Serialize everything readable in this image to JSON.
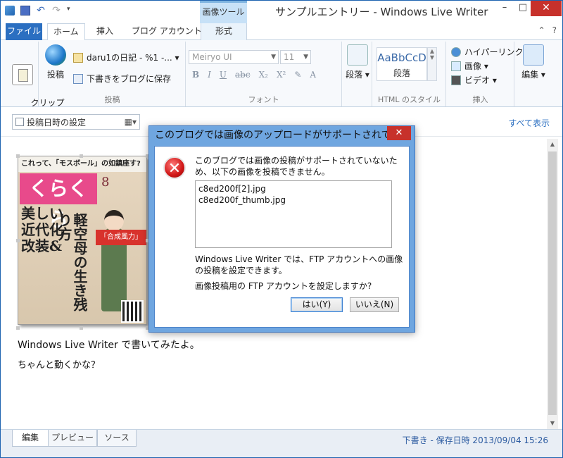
{
  "window": {
    "title": "サンプルエントリー - Windows Live Writer",
    "contextual_tab_group": "画像ツール",
    "controls": {
      "minimize": "–",
      "maximize": "□",
      "close": "✕"
    }
  },
  "quick_access": {
    "undo": "↶",
    "redo": "↷",
    "dropdown": "▾"
  },
  "tabs": {
    "file": "ファイル",
    "home": "ホーム",
    "insert": "挿入",
    "blog_account": "ブログ アカウント",
    "format": "形式"
  },
  "ribbon_right": {
    "help": "?",
    "expand": "⌃"
  },
  "ribbon": {
    "clipboard": {
      "label": "クリップ\nボード ▾"
    },
    "post": {
      "publish_label": "投稿",
      "blog_selector": "daru1の日記 - %1 -... ▾",
      "save_draft_label": "下書きをブログに保存",
      "group_label": "投稿"
    },
    "font": {
      "font_name": "Meiryo UI",
      "font_size": "11",
      "group_label": "フォント",
      "buttons": [
        "B",
        "I",
        "U",
        "abc",
        "X₂",
        "X²",
        "✎",
        "A"
      ]
    },
    "paragraph": {
      "label": "段落 ▾"
    },
    "html_styles": {
      "sample": "AaBbCcD",
      "name": "段落",
      "group_label": "HTML のスタイル"
    },
    "insert": {
      "hyperlink": "ハイパーリンク",
      "image": "画像 ▾",
      "video": "ビデオ ▾",
      "group_label": "挿入"
    },
    "editing": {
      "label": "編集 ▾"
    }
  },
  "option_bar": {
    "post_date_label": "投稿日時の設定",
    "show_all": "すべて表示"
  },
  "editor": {
    "magazine": {
      "top_strip": "これって、「モスボール」の如鎮座す?",
      "logo": "くらくら",
      "month": "8",
      "headline_left": "美しい近代化改装&",
      "headline_vertical": "軽空母の生き残り方",
      "banner": "「合成風力」"
    },
    "line1": "Windows Live Writer で書いてみたよ。",
    "line2": "ちゃんと動くかな？"
  },
  "bottom": {
    "tab_edit": "編集",
    "tab_preview": "プレビュー",
    "tab_source": "ソース",
    "status": "下書き - 保存日時 2013/09/04 15:26"
  },
  "dialog": {
    "title": "このブログでは画像のアップロードがサポートされていま...",
    "close": "✕",
    "message": "このブログでは画像の投稿がサポートされていないため、以下の画像を投稿できません。",
    "files": [
      "c8ed200f[2].jpg",
      "c8ed200f_thumb.jpg"
    ],
    "message2": "Windows Live Writer では、FTP アカウントへの画像の投稿を設定できます。",
    "message3": "画像投稿用の FTP アカウントを設定しますか?",
    "yes": "はい(Y)",
    "no": "いいえ(N)"
  },
  "colors": {
    "accent": "#2b6fc1",
    "dialog_frame": "#6fa6e0",
    "close_red": "#c7312b"
  }
}
